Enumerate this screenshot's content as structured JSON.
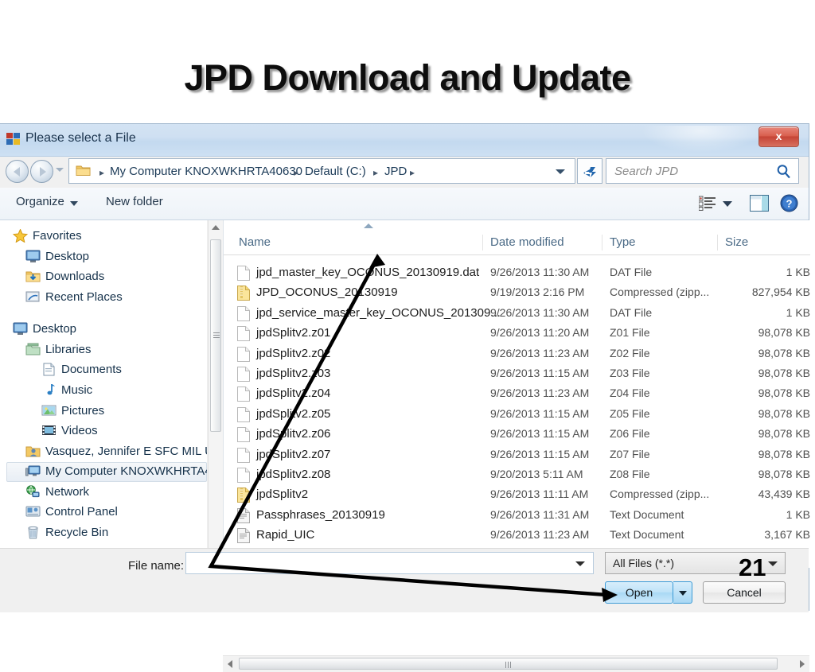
{
  "slide": {
    "title": "JPD Download and Update"
  },
  "dialog": {
    "title": "Please select a File",
    "title_icon": "app-window-icon",
    "close_label": "x"
  },
  "address": {
    "folder_icon": "folder-icon",
    "crumbs": [
      "My Computer KNOXWKHRTA40630",
      "Default (C:)",
      "JPD"
    ],
    "separator": "▸",
    "refresh_icon": "refresh-icon"
  },
  "search": {
    "placeholder": "Search JPD",
    "icon": "search-icon"
  },
  "commandbar": {
    "organize": "Organize",
    "new_folder": "New folder",
    "views_icon": "view-list-icon",
    "preview_icon": "preview-pane-icon",
    "help_icon": "help-icon"
  },
  "navpane": {
    "items": [
      {
        "label": "Favorites",
        "icon": "star-icon",
        "indent": 0,
        "selected": false
      },
      {
        "label": "Desktop",
        "icon": "monitor-icon",
        "indent": 1,
        "selected": false
      },
      {
        "label": "Downloads",
        "icon": "downloads-icon",
        "indent": 1,
        "selected": false
      },
      {
        "label": "Recent Places",
        "icon": "recent-icon",
        "indent": 1,
        "selected": false
      },
      {
        "label": "Desktop",
        "icon": "monitor-icon",
        "indent": 0,
        "selected": false
      },
      {
        "label": "Libraries",
        "icon": "library-icon",
        "indent": 1,
        "selected": false
      },
      {
        "label": "Documents",
        "icon": "document-icon",
        "indent": 2,
        "selected": false
      },
      {
        "label": "Music",
        "icon": "music-note-icon",
        "indent": 2,
        "selected": false
      },
      {
        "label": "Pictures",
        "icon": "picture-icon",
        "indent": 2,
        "selected": false
      },
      {
        "label": "Videos",
        "icon": "video-icon",
        "indent": 2,
        "selected": false
      },
      {
        "label": "Vasquez, Jennifer E SFC MIL US",
        "icon": "user-folder-icon",
        "indent": 1,
        "selected": false
      },
      {
        "label": "My Computer KNOXWKHRTA4",
        "icon": "computer-icon",
        "indent": 1,
        "selected": true
      },
      {
        "label": "Network",
        "icon": "network-icon",
        "indent": 1,
        "selected": false
      },
      {
        "label": "Control Panel",
        "icon": "control-panel-icon",
        "indent": 1,
        "selected": false
      },
      {
        "label": "Recycle Bin",
        "icon": "recycle-bin-icon",
        "indent": 1,
        "selected": false
      }
    ]
  },
  "filelist": {
    "columns": [
      "Name",
      "Date modified",
      "Type",
      "Size"
    ],
    "sorted_by": "Name",
    "sort_direction": "ascending",
    "rows": [
      {
        "name": "jpd_master_key_OCONUS_20130919.dat",
        "icon": "generic-file-icon",
        "date": "9/26/2013 11:30 AM",
        "type": "DAT File",
        "size": "1 KB"
      },
      {
        "name": "JPD_OCONUS_20130919",
        "icon": "zip-file-icon",
        "date": "9/19/2013 2:16 PM",
        "type": "Compressed (zipp...",
        "size": "827,954 KB"
      },
      {
        "name": "jpd_service_master_key_OCONUS_201309...",
        "icon": "generic-file-icon",
        "date": "9/26/2013 11:30 AM",
        "type": "DAT File",
        "size": "1 KB"
      },
      {
        "name": "jpdSplitv2.z01",
        "icon": "generic-file-icon",
        "date": "9/26/2013 11:20 AM",
        "type": "Z01 File",
        "size": "98,078 KB"
      },
      {
        "name": "jpdSplitv2.z02",
        "icon": "generic-file-icon",
        "date": "9/26/2013 11:23 AM",
        "type": "Z02 File",
        "size": "98,078 KB"
      },
      {
        "name": "jpdSplitv2.z03",
        "icon": "generic-file-icon",
        "date": "9/26/2013 11:15 AM",
        "type": "Z03 File",
        "size": "98,078 KB"
      },
      {
        "name": "jpdSplitv2.z04",
        "icon": "generic-file-icon",
        "date": "9/26/2013 11:23 AM",
        "type": "Z04 File",
        "size": "98,078 KB"
      },
      {
        "name": "jpdSplitv2.z05",
        "icon": "generic-file-icon",
        "date": "9/26/2013 11:15 AM",
        "type": "Z05 File",
        "size": "98,078 KB"
      },
      {
        "name": "jpdSplitv2.z06",
        "icon": "generic-file-icon",
        "date": "9/26/2013 11:15 AM",
        "type": "Z06 File",
        "size": "98,078 KB"
      },
      {
        "name": "jpdSplitv2.z07",
        "icon": "generic-file-icon",
        "date": "9/26/2013 11:15 AM",
        "type": "Z07 File",
        "size": "98,078 KB"
      },
      {
        "name": "jpdSplitv2.z08",
        "icon": "generic-file-icon",
        "date": "9/20/2013 5:11 AM",
        "type": "Z08 File",
        "size": "98,078 KB"
      },
      {
        "name": "jpdSplitv2",
        "icon": "zip-file-icon",
        "date": "9/26/2013 11:11 AM",
        "type": "Compressed (zipp...",
        "size": "43,439 KB"
      },
      {
        "name": "Passphrases_20130919",
        "icon": "text-file-icon",
        "date": "9/26/2013 11:31 AM",
        "type": "Text Document",
        "size": "1 KB"
      },
      {
        "name": "Rapid_UIC",
        "icon": "text-file-icon",
        "date": "9/26/2013 11:23 AM",
        "type": "Text Document",
        "size": "3,167 KB"
      }
    ]
  },
  "footer": {
    "filename_label": "File name:",
    "filename_value": "",
    "filetype_value": "All Files (*.*)",
    "open_label": "Open",
    "cancel_label": "Cancel"
  },
  "annotation": {
    "step_number": "21"
  },
  "colors": {
    "titlebar": "#c9dcef",
    "close_red": "#c64436",
    "open_blue": "#a9d8f4",
    "crumb_text": "#1b3a57",
    "column_header": "#4a6a86"
  }
}
